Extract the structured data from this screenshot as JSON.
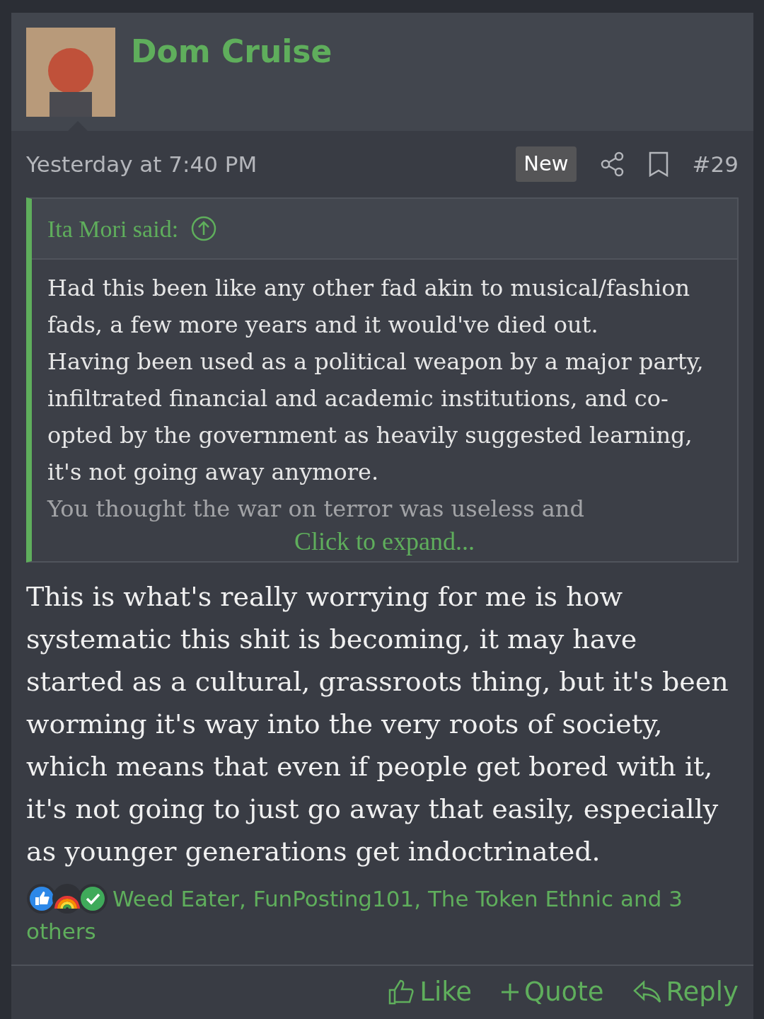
{
  "post": {
    "author": "Dom Cruise",
    "time": "Yesterday at 7:40 PM",
    "badge": "New",
    "number": "#29",
    "quote": {
      "attribution": "Ita Mori said:",
      "paragraphs": [
        "Had this been like any other fad akin to musical/fashion fads, a few more years and it would've died out.",
        "Having been used as a political weapon by a major party, infiltrated financial and academic institutions, and co-opted by the government as heavily suggested learning, it's not going away anymore.",
        "You thought the war on terror was useless and"
      ],
      "expand": "Click to expand..."
    },
    "body": "This is what's really worrying for me is how systematic this shit is becoming, it may have started as a cultural, grassroots thing, but it's been worming it's way into the very roots of society, which means that even if people get bored with it, it's not going to just go away that easily, especially as younger generations get indoctrinated.",
    "reactions": {
      "text_lines": [
        "Weed Eater, FunPosting101, The Token Ethnic and 3",
        "others"
      ]
    },
    "actions": [
      {
        "kind": "like",
        "label": "Like"
      },
      {
        "kind": "quote",
        "label": "Quote"
      },
      {
        "kind": "reply",
        "label": "Reply"
      }
    ]
  }
}
